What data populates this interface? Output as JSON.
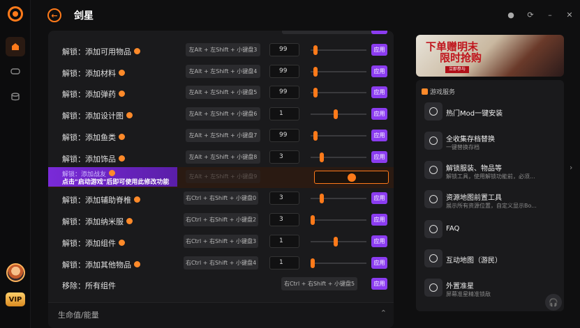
{
  "app": {
    "title": "剑星",
    "vip": "VIP"
  },
  "rows": [
    {
      "label": "解锁：添加可用物品",
      "hotkey": "左Alt + 左Shift + 小键盘3",
      "value": "99",
      "knob": 0.05,
      "apply": "应用"
    },
    {
      "label": "解锁：添加材料",
      "hotkey": "左Alt + 左Shift + 小键盘4",
      "value": "99",
      "knob": 0.05,
      "apply": "应用"
    },
    {
      "label": "解锁：添加弹药",
      "hotkey": "左Alt + 左Shift + 小键盘5",
      "value": "99",
      "knob": 0.05,
      "apply": "应用"
    },
    {
      "label": "解锁：添加设计图",
      "hotkey": "左Alt + 左Shift + 小键盘6",
      "value": "1",
      "knob": 0.45,
      "apply": "应用"
    },
    {
      "label": "解锁：添加鱼类",
      "hotkey": "左Alt + 左Shift + 小键盘7",
      "value": "99",
      "knob": 0.05,
      "apply": "应用"
    },
    {
      "label": "解锁：添加饰品",
      "hotkey": "左Alt + 左Shift + 小键盘8",
      "value": "3",
      "knob": 0.18,
      "apply": "应用"
    },
    {
      "label": "解锁：添加辅助脊椎",
      "hotkey": "右Ctrl + 右Shift + 小键盘0",
      "value": "3",
      "knob": 0.18,
      "apply": "应用"
    },
    {
      "label": "解锁：添加纳米服",
      "hotkey": "右Ctrl + 右Shift + 小键盘2",
      "value": "3",
      "knob": 0.0,
      "apply": "应用"
    },
    {
      "label": "解锁：添加组件",
      "hotkey": "右Ctrl + 右Shift + 小键盘3",
      "value": "1",
      "knob": 0.45,
      "apply": "应用"
    },
    {
      "label": "解锁：添加其他物品",
      "hotkey": "右Ctrl + 右Shift + 小键盘4",
      "value": "1",
      "knob": 0.0,
      "apply": "应用"
    }
  ],
  "locked_row": {
    "label": "解锁：添加战友",
    "banner_sub": "点击\"启动游戏\"后即可使用此修改功能",
    "hotkey": "左Alt + 左Shift + 小键盘9",
    "apply": "应用"
  },
  "remove_row": {
    "label": "移除：所有组件",
    "hotkey": "右Ctrl + 右Shift + 小键盘5",
    "apply": "应用"
  },
  "section": {
    "title": "生命值/能量"
  },
  "ad": {
    "line1": "下单赠明末",
    "line2": "限时抢购",
    "cta": "立即参与"
  },
  "services": {
    "header": "游戏服务",
    "items": [
      {
        "name": "热门Mod一键安装",
        "desc": ""
      },
      {
        "name": "全收集存档替换",
        "desc": "一键替换存档"
      },
      {
        "name": "解锁服装、物品等",
        "desc": "解锁工具，使用解锁功能前，必须..."
      },
      {
        "name": "资源地图前置工具",
        "desc": "展示所有资源位置，自定义显示Bo..."
      },
      {
        "name": "FAQ",
        "desc": ""
      },
      {
        "name": "互动地图（游民）",
        "desc": ""
      },
      {
        "name": "外置准星",
        "desc": "屏幕准星精准锁敌"
      }
    ]
  },
  "colors": {
    "accent": "#ff7a1a",
    "apply": "#8b3cf0",
    "bg": "#0f0f10"
  }
}
